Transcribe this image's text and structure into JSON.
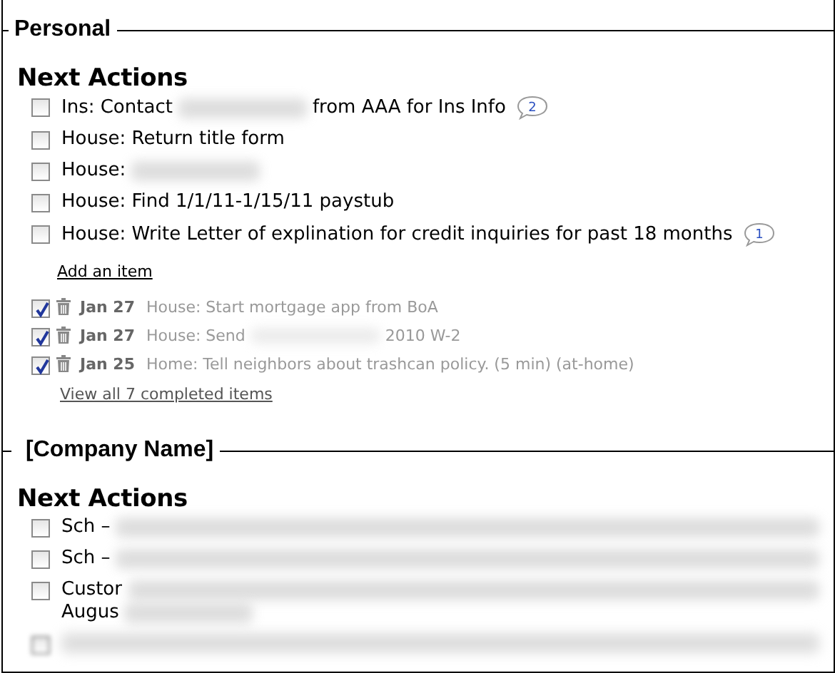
{
  "sections": [
    {
      "title": "Personal",
      "heading": "Next Actions",
      "tasks": [
        {
          "kind": "task",
          "checked": false,
          "segments": [
            {
              "kind": "text",
              "text": "Ins: Contact"
            },
            {
              "kind": "redacted"
            },
            {
              "kind": "text",
              "text": "from AAA for Ins Info"
            }
          ],
          "comments": "2"
        },
        {
          "kind": "task",
          "checked": false,
          "segments": [
            {
              "kind": "text",
              "text": "House: Return title form"
            }
          ]
        },
        {
          "kind": "task",
          "checked": false,
          "segments": [
            {
              "kind": "text",
              "text": "House:"
            },
            {
              "kind": "redacted"
            }
          ]
        },
        {
          "kind": "task",
          "checked": false,
          "segments": [
            {
              "kind": "text",
              "text": "House: Find 1/1/11-1/15/11 paystub"
            }
          ]
        },
        {
          "kind": "task",
          "checked": false,
          "segments": [
            {
              "kind": "text",
              "text": "House: Write Letter of explination for credit inquiries for past 18 months"
            }
          ],
          "comments": "1"
        }
      ],
      "add_link": "Add an item",
      "completed": [
        {
          "checked": true,
          "date": "Jan 27",
          "segments": [
            {
              "kind": "text",
              "text": "House: Start mortgage app from BoA"
            }
          ]
        },
        {
          "checked": true,
          "date": "Jan 27",
          "segments": [
            {
              "kind": "text",
              "text": "House: Send"
            },
            {
              "kind": "redacted"
            },
            {
              "kind": "text",
              "text": "2010 W-2"
            }
          ]
        },
        {
          "checked": true,
          "date": "Jan 25",
          "segments": [
            {
              "kind": "text",
              "text": "Home: Tell neighbors about trashcan policy. (5 min) (at-home)"
            }
          ]
        }
      ],
      "view_all_link": "View all 7 completed items"
    },
    {
      "title": "[Company Name]",
      "heading": "Next Actions",
      "tasks": [
        {
          "kind": "task",
          "checked": false,
          "segments": [
            {
              "kind": "text",
              "text": "Sch –"
            },
            {
              "kind": "redacted_line"
            }
          ]
        },
        {
          "kind": "task",
          "checked": false,
          "segments": [
            {
              "kind": "text",
              "text": "Sch –"
            },
            {
              "kind": "redacted_line"
            }
          ]
        },
        {
          "kind": "task",
          "checked": false,
          "segments": [
            {
              "kind": "text",
              "text": "Custor"
            },
            {
              "kind": "redacted_line"
            },
            {
              "kind": "break"
            },
            {
              "kind": "text",
              "text": "Augus"
            },
            {
              "kind": "redacted"
            }
          ]
        },
        {
          "kind": "hidden",
          "checked": false,
          "segments": [
            {
              "kind": "redacted_line"
            }
          ]
        }
      ]
    }
  ]
}
